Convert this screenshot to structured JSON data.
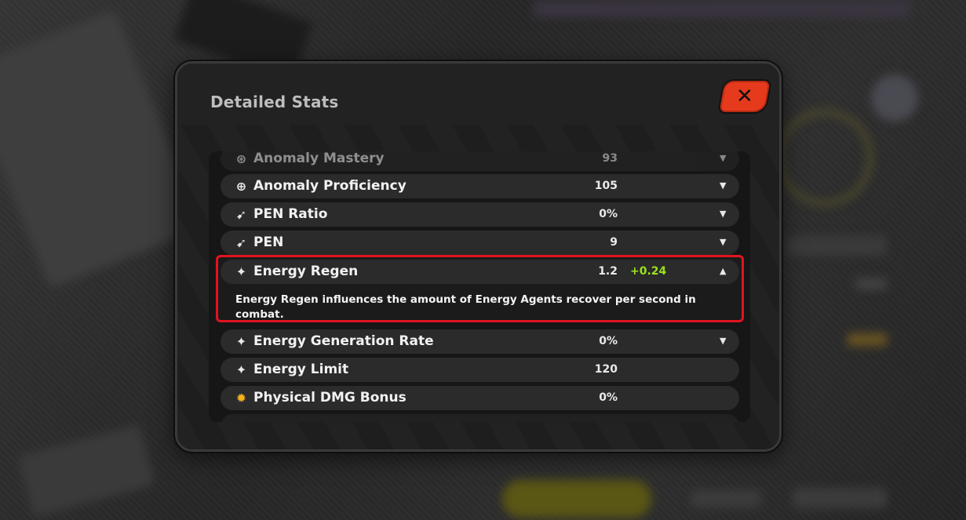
{
  "dialog": {
    "title": "Detailed Stats",
    "close_label": "✕"
  },
  "stats": [
    {
      "icon": "anomaly-mastery-icon",
      "glyph": "⊛",
      "label": "Anomaly Mastery",
      "value": "93",
      "caret": "▼"
    },
    {
      "icon": "anomaly-proficiency-icon",
      "glyph": "⊕",
      "label": "Anomaly Proficiency",
      "value": "105",
      "caret": "▼"
    },
    {
      "icon": "pen-ratio-icon",
      "glyph": "➹",
      "label": "PEN Ratio",
      "value": "0%",
      "caret": "▼"
    },
    {
      "icon": "pen-icon",
      "glyph": "➹",
      "label": "PEN",
      "value": "9",
      "caret": "▼"
    }
  ],
  "expanded_stat": {
    "icon": "energy-regen-icon",
    "glyph": "✦",
    "label": "Energy Regen",
    "value": "1.2",
    "bonus": "+0.24",
    "caret": "▲",
    "description": "Energy Regen influences the amount of Energy Agents recover per second in combat."
  },
  "stats_after": [
    {
      "icon": "energy-generation-rate-icon",
      "glyph": "✦",
      "label": "Energy Generation Rate",
      "value": "0%",
      "caret": "▼"
    },
    {
      "icon": "energy-limit-icon",
      "glyph": "✦",
      "label": "Energy Limit",
      "value": "120",
      "caret": ""
    },
    {
      "icon": "physical-dmg-bonus-icon",
      "glyph": "✹",
      "label": "Physical DMG Bonus",
      "value": "0%",
      "caret": ""
    }
  ],
  "colors": {
    "accent_red": "#e0141e",
    "bonus_green": "#9be21e",
    "close_button": "#e63a1d",
    "physical_icon": "#f5b21b"
  }
}
